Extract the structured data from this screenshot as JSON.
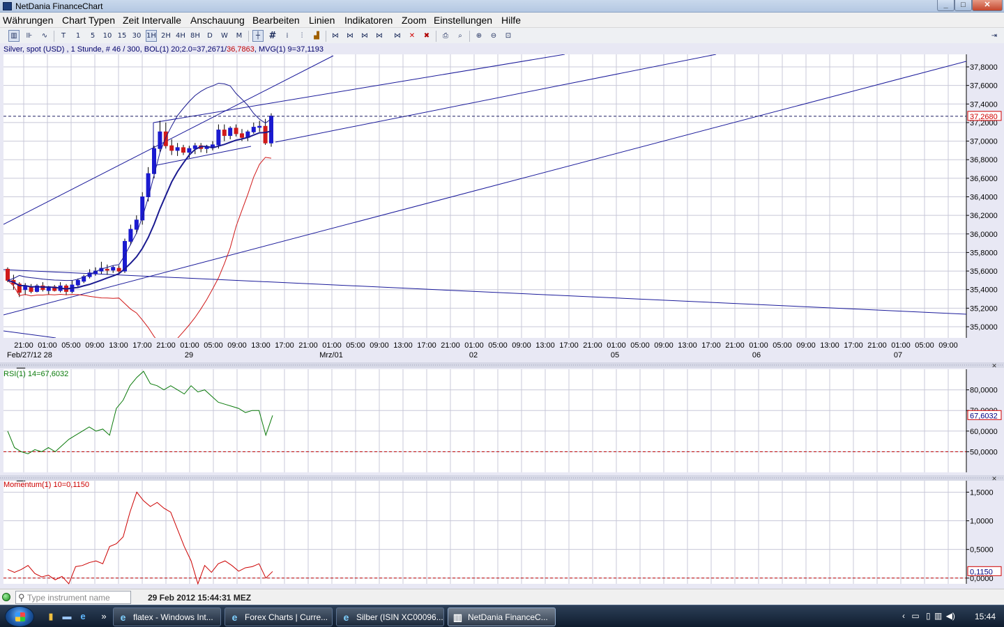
{
  "window": {
    "title": "NetDania FinanceChart",
    "min": "_",
    "max": "□",
    "close": "✕"
  },
  "menu": [
    "Währungen",
    "Chart Typen",
    "Zeit Intervalle",
    "Anschauung",
    "Bearbeiten",
    "Linien",
    "Indikatoren",
    "Zoom",
    "Einstellungen",
    "Hilfe"
  ],
  "toolbar": {
    "intervals": [
      "T",
      "1",
      "5",
      "10",
      "15",
      "30",
      "1H",
      "2H",
      "4H",
      "8H",
      "D",
      "W",
      "M"
    ],
    "selected_interval": "1H"
  },
  "chart": {
    "info_main": "Silver, spot (USD) , 1 Stunde, # 46 / 300, BOL(1) 20;2.0=37,2671/",
    "info_bol_lower": "36,7863",
    "info_mvg": ", MVG(1) 9=37,1193",
    "price_ticks": [
      "37,8000",
      "37,6000",
      "37,4000",
      "37,2000",
      "37,0000",
      "36,8000",
      "36,6000",
      "36,4000",
      "36,2000",
      "36,0000",
      "35,8000",
      "35,6000",
      "35,4000",
      "35,2000",
      "35,0000"
    ],
    "current_price": "37,2680",
    "time_ticks": [
      "21:00",
      "01:00",
      "05:00",
      "09:00",
      "13:00",
      "17:00",
      "21:00",
      "01:00",
      "05:00",
      "09:00",
      "13:00",
      "17:00",
      "21:00",
      "01:00",
      "05:00",
      "09:00",
      "13:00",
      "17:00",
      "21:00",
      "01:00",
      "05:00",
      "09:00",
      "13:00",
      "17:00",
      "21:00",
      "01:00",
      "05:00",
      "09:00",
      "13:00",
      "17:00",
      "21:00",
      "01:00",
      "05:00",
      "09:00",
      "13:00",
      "17:00",
      "21:00",
      "01:00",
      "05:00",
      "09:00"
    ],
    "date_labels": [
      {
        "text": "Feb/27/12 28",
        "at": "21:00"
      },
      {
        "text": "29",
        "at": "01:00 #2"
      },
      {
        "text": "Mrz/01",
        "at": "01:00 #3"
      },
      {
        "text": "02",
        "at": "01:00 #4"
      },
      {
        "text": "05",
        "at": "01:00 #5"
      },
      {
        "text": "06",
        "at": "01:00 #6"
      },
      {
        "text": "07",
        "at": "01:00 #7"
      }
    ]
  },
  "rsi": {
    "label": "RSI(1) 14=67,6032",
    "ticks": [
      "80,0000",
      "70,0000",
      "60,0000",
      "50,0000"
    ],
    "current": "67,6032"
  },
  "momentum": {
    "label": "Momentum(1) 10=0,1150",
    "ticks": [
      "1,5000",
      "1,0000",
      "0,5000",
      "0,0000"
    ],
    "current": "0,1150"
  },
  "status": {
    "search_placeholder": "Type instrument name",
    "datetime": "29 Feb 2012 15:44:31 MEZ"
  },
  "taskbar": {
    "tasks": [
      "flatex - Windows Int...",
      "Forex Charts | Curre...",
      "Silber (ISIN XC00096...",
      "NetDania FinanceC..."
    ],
    "clock": "15:44"
  },
  "colors": {
    "candle_up": "#1a1ad0",
    "candle_down": "#d01a1a",
    "bollinger": "#1a1a90",
    "bollinger_lower": "#d01818",
    "rsi": "#0a7a0a",
    "momentum": "#cc0000",
    "grid": "#c8c8d8"
  },
  "chart_data": {
    "type": "candlestick",
    "instrument": "Silver, spot (USD)",
    "interval": "1 Stunde",
    "price_range": [
      34.9,
      37.9
    ],
    "candles": [
      {
        "o": 35.62,
        "h": 35.64,
        "l": 35.48,
        "c": 35.5
      },
      {
        "o": 35.5,
        "h": 35.56,
        "l": 35.4,
        "c": 35.46
      },
      {
        "o": 35.46,
        "h": 35.48,
        "l": 35.32,
        "c": 35.37
      },
      {
        "o": 35.4,
        "h": 35.47,
        "l": 35.34,
        "c": 35.44
      },
      {
        "o": 35.43,
        "h": 35.46,
        "l": 35.36,
        "c": 35.38
      },
      {
        "o": 35.38,
        "h": 35.46,
        "l": 35.37,
        "c": 35.44
      },
      {
        "o": 35.44,
        "h": 35.48,
        "l": 35.38,
        "c": 35.4
      },
      {
        "o": 35.39,
        "h": 35.44,
        "l": 35.35,
        "c": 35.43
      },
      {
        "o": 35.43,
        "h": 35.45,
        "l": 35.38,
        "c": 35.39
      },
      {
        "o": 35.39,
        "h": 35.48,
        "l": 35.37,
        "c": 35.44
      },
      {
        "o": 35.44,
        "h": 35.46,
        "l": 35.34,
        "c": 35.38
      },
      {
        "o": 35.38,
        "h": 35.5,
        "l": 35.36,
        "c": 35.45
      },
      {
        "o": 35.45,
        "h": 35.52,
        "l": 35.43,
        "c": 35.5
      },
      {
        "o": 35.49,
        "h": 35.56,
        "l": 35.47,
        "c": 35.54
      },
      {
        "o": 35.54,
        "h": 35.62,
        "l": 35.52,
        "c": 35.58
      },
      {
        "o": 35.57,
        "h": 35.64,
        "l": 35.55,
        "c": 35.6
      },
      {
        "o": 35.6,
        "h": 35.7,
        "l": 35.57,
        "c": 35.63
      },
      {
        "o": 35.62,
        "h": 35.67,
        "l": 35.56,
        "c": 35.61
      },
      {
        "o": 35.61,
        "h": 35.66,
        "l": 35.58,
        "c": 35.64
      },
      {
        "o": 35.63,
        "h": 35.66,
        "l": 35.57,
        "c": 35.6
      },
      {
        "o": 35.6,
        "h": 35.95,
        "l": 35.58,
        "c": 35.92
      },
      {
        "o": 35.92,
        "h": 36.1,
        "l": 35.88,
        "c": 36.05
      },
      {
        "o": 36.05,
        "h": 36.2,
        "l": 36.0,
        "c": 36.15
      },
      {
        "o": 36.15,
        "h": 36.45,
        "l": 36.1,
        "c": 36.4
      },
      {
        "o": 36.4,
        "h": 36.72,
        "l": 36.35,
        "c": 36.65
      },
      {
        "o": 36.65,
        "h": 36.95,
        "l": 36.6,
        "c": 36.92
      },
      {
        "o": 36.92,
        "h": 37.22,
        "l": 36.88,
        "c": 37.1
      },
      {
        "o": 37.1,
        "h": 37.2,
        "l": 36.92,
        "c": 36.95
      },
      {
        "o": 36.95,
        "h": 37.02,
        "l": 36.85,
        "c": 36.9
      },
      {
        "o": 36.9,
        "h": 36.98,
        "l": 36.84,
        "c": 36.93
      },
      {
        "o": 36.93,
        "h": 36.96,
        "l": 36.85,
        "c": 36.88
      },
      {
        "o": 36.88,
        "h": 36.95,
        "l": 36.82,
        "c": 36.92
      },
      {
        "o": 36.92,
        "h": 36.98,
        "l": 36.86,
        "c": 36.95
      },
      {
        "o": 36.95,
        "h": 36.98,
        "l": 36.88,
        "c": 36.92
      },
      {
        "o": 36.92,
        "h": 36.96,
        "l": 36.87,
        "c": 36.94
      },
      {
        "o": 36.94,
        "h": 37.0,
        "l": 36.9,
        "c": 36.96
      },
      {
        "o": 36.96,
        "h": 37.18,
        "l": 36.92,
        "c": 37.12
      },
      {
        "o": 37.12,
        "h": 37.18,
        "l": 37.0,
        "c": 37.06
      },
      {
        "o": 37.06,
        "h": 37.16,
        "l": 37.02,
        "c": 37.14
      },
      {
        "o": 37.14,
        "h": 37.18,
        "l": 37.05,
        "c": 37.08
      },
      {
        "o": 37.08,
        "h": 37.13,
        "l": 37.0,
        "c": 37.04
      },
      {
        "o": 37.04,
        "h": 37.12,
        "l": 37.0,
        "c": 37.1
      },
      {
        "o": 37.1,
        "h": 37.2,
        "l": 37.08,
        "c": 37.15
      },
      {
        "o": 37.15,
        "h": 37.22,
        "l": 37.1,
        "c": 37.16
      },
      {
        "o": 37.16,
        "h": 37.24,
        "l": 36.96,
        "c": 36.98
      },
      {
        "o": 36.98,
        "h": 37.3,
        "l": 36.94,
        "c": 37.27
      }
    ],
    "rsi_range": [
      40,
      90
    ],
    "rsi_values": [
      60,
      52,
      50,
      49,
      51,
      50,
      52,
      50,
      53,
      56,
      58,
      60,
      62,
      60,
      61,
      58,
      71,
      75,
      82,
      86,
      89,
      83,
      82,
      80,
      82,
      80,
      78,
      82,
      79,
      80,
      77,
      74,
      73,
      72,
      71,
      69,
      70,
      70,
      58,
      67.6
    ],
    "momentum_range": [
      -0.1,
      1.7
    ],
    "momentum_values": [
      0.15,
      0.1,
      0.15,
      0.22,
      0.08,
      0.02,
      0.05,
      -0.03,
      0.03,
      -0.1,
      0.2,
      0.22,
      0.27,
      0.3,
      0.25,
      0.55,
      0.6,
      0.72,
      1.15,
      1.5,
      1.35,
      1.25,
      1.32,
      1.22,
      1.15,
      0.85,
      0.55,
      0.3,
      -0.1,
      0.22,
      0.1,
      0.25,
      0.3,
      0.22,
      0.12,
      0.18,
      0.2,
      0.25,
      0.0,
      0.115
    ]
  }
}
